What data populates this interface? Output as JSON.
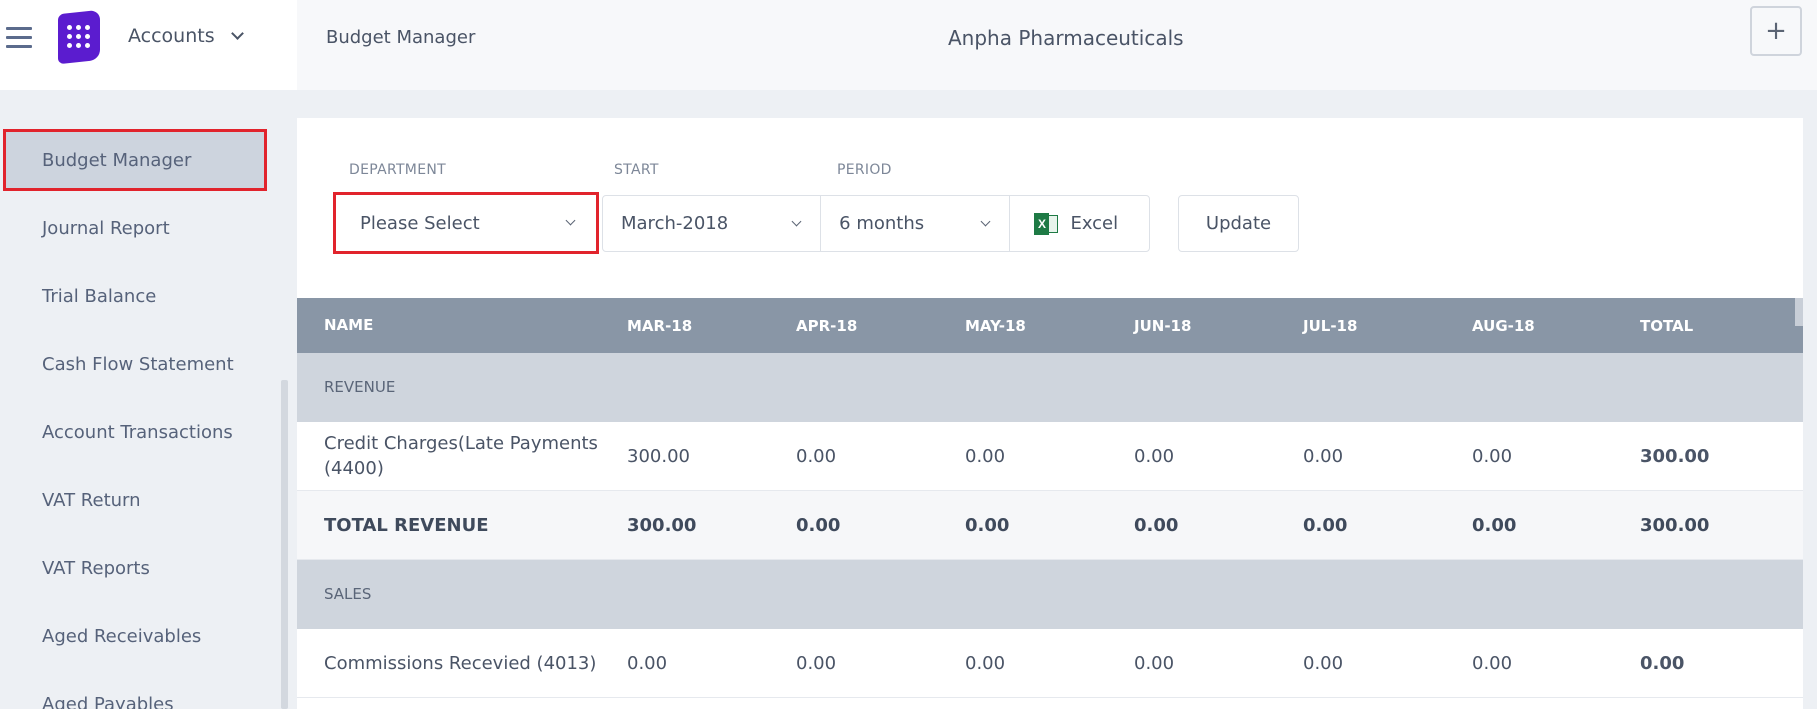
{
  "topbar": {
    "module": "Accounts",
    "crumb": "Budget Manager",
    "company": "Anpha Pharmaceuticals",
    "add_label": "+"
  },
  "sidebar": {
    "items": [
      {
        "label": "Budget Manager",
        "active": true
      },
      {
        "label": "Journal Report"
      },
      {
        "label": "Trial Balance"
      },
      {
        "label": "Cash Flow Statement"
      },
      {
        "label": "Account Transactions"
      },
      {
        "label": "VAT Return"
      },
      {
        "label": "VAT Reports"
      },
      {
        "label": "Aged Receivables"
      },
      {
        "label": "Aged Payables"
      }
    ]
  },
  "filters": {
    "department_label": "DEPARTMENT",
    "department_value": "Please Select",
    "start_label": "START",
    "start_value": "March-2018",
    "period_label": "PERIOD",
    "period_value": "6 months",
    "excel_label": "Excel",
    "update_label": "Update"
  },
  "table": {
    "headers": [
      "NAME",
      "MAR-18",
      "APR-18",
      "MAY-18",
      "JUN-18",
      "JUL-18",
      "AUG-18",
      "TOTAL"
    ],
    "rows": [
      {
        "type": "section",
        "cells": [
          "REVENUE"
        ]
      },
      {
        "type": "item",
        "cells": [
          "Credit Charges(Late Payments (4400)",
          "300.00",
          "0.00",
          "0.00",
          "0.00",
          "0.00",
          "0.00",
          "300.00"
        ]
      },
      {
        "type": "total",
        "cells": [
          "TOTAL REVENUE",
          "300.00",
          "0.00",
          "0.00",
          "0.00",
          "0.00",
          "0.00",
          "300.00"
        ]
      },
      {
        "type": "section",
        "cells": [
          "SALES"
        ]
      },
      {
        "type": "item",
        "cells": [
          "Commissions Recevied (4013)",
          "0.00",
          "0.00",
          "0.00",
          "0.00",
          "0.00",
          "0.00",
          "0.00"
        ]
      }
    ]
  },
  "colors": {
    "accent_logo": "#5b1ccf",
    "highlight": "#e1232c",
    "table_header": "#8996a6",
    "section_row": "#cfd5dd",
    "excel_green": "#1e7a45"
  },
  "icons": {
    "menu": "hamburger-icon",
    "logo": "app-grid-icon",
    "dropdown": "chevron-down-icon",
    "excel": "excel-icon",
    "add": "plus-icon"
  }
}
